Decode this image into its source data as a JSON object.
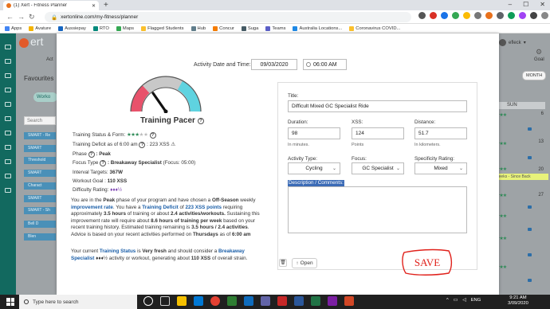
{
  "browser": {
    "tab_title": "(1) Xert - Fitness Planner",
    "new_tab": "+",
    "url": "xertonline.com/my-fitness/planner",
    "window_controls": [
      "–",
      "☐",
      "✕"
    ],
    "bookmarks": [
      "Apps",
      "Avature",
      "Aussiepay",
      "RTO",
      "Maps",
      "Flagged Students",
      "Hub",
      "Concur",
      "Suga",
      "Teams",
      "Australia Locations...",
      "Coronavirus COVID..."
    ]
  },
  "app": {
    "logo_text": "ert",
    "user_name": "efleck",
    "goal_label": "Goal",
    "month_button": "MONTH",
    "activity_tab": "Act",
    "favourites_title": "Favourites",
    "workouts_button": "Worko",
    "search_placeholder": "Search",
    "left_buttons": [
      "SMART - Re",
      "SMART",
      "Threshold",
      "SMART",
      "Charact",
      "SMART",
      "SMART - Sh",
      "Bell D",
      "Blen"
    ],
    "calendar_header": "SUN",
    "calendar_days": [
      "6",
      "13",
      "20",
      "27"
    ],
    "weeks_banner": "Weeks - Since Back"
  },
  "modal": {
    "date_label": "Activity Date and Time:",
    "date_value": "09/03/2020",
    "time_value": "06:00 AM",
    "pacer_title": "Training Pacer",
    "status_label": "Training Status & Form:",
    "deficit_text": "Training Deficit as of 6:00 am",
    "deficit_value": ": 223 XSS",
    "phase_label": "Phase",
    "phase_value": ": Peak",
    "focus_label": "Focus Type",
    "focus_value": ": Breakaway Specialist",
    "focus_extra": "(Focus: 05:00)",
    "interval_label": "Interval Targets:",
    "interval_value": "367W",
    "goal_label": "Workout Goal :",
    "goal_value": "110 XSS",
    "difficulty_label": "Difficulty Rating:",
    "difficulty_value": "♦♦♦½",
    "p1_a": "You are in the",
    "p1_peak": "Peak",
    "p1_b": "phase of your program and have chosen a",
    "p1_offseason": "Off-Season",
    "p1_c": "weekly",
    "p1_improvement": "improvement rate",
    "p1_d": ". You have a",
    "p1_deficit": "Training Deficit",
    "p1_e": "of",
    "p1_xss": "223 XSS points",
    "p1_f": "requiring approximately",
    "p1_hours": "3.5 hours",
    "p1_g": "of training or about",
    "p1_acts": "2.4 activities/workouts.",
    "p1_h": "Sustaining this improvement rate will require about",
    "p1_weekly": "8.6 hours of training per week",
    "p1_i": "based on your recent training history. Estimated training remaining is",
    "p1_remaining": "3.5 hours / 2.4 activities",
    "p1_j": ".",
    "p1_k": "Advice is based on your recent activities performed on",
    "p1_day": "Thursdays",
    "p1_l": "as of",
    "p1_time": "6:00 am",
    "p2_a": "Your current",
    "p2_status": "Training Status",
    "p2_b": "is",
    "p2_fresh": "Very fresh",
    "p2_c": "and should consider a",
    "p2_breakaway": "Breakaway Specialist",
    "p2_d": "♦♦♦½ activity or workout, generating about",
    "p2_xss": "110 XSS",
    "p2_e": "of overall strain.",
    "title_label": "Title:",
    "title_value": "Difficult Mixed GC Specialist Ride",
    "duration_label": "Duration:",
    "duration_value": "98",
    "duration_unit": "In minutes.",
    "xss_label": "XSS:",
    "xss_value": "124",
    "xss_unit": "Points",
    "distance_label": "Distance:",
    "distance_value": "51.7",
    "distance_unit": "In kilometers.",
    "activity_type_label": "Activity Type:",
    "activity_type_value": "Cycling",
    "focus_sel_label": "Focus:",
    "focus_sel_value": "GC Specialist",
    "specificity_label": "Specificity Rating:",
    "specificity_value": "Mixed",
    "description_label": "Description / Comments:",
    "open_button": "Open",
    "save_annotation": "SAVE"
  },
  "taskbar": {
    "search_placeholder": "Type here to search",
    "language": "ENG",
    "time": "9:21 AM",
    "date": "3/09/2020"
  },
  "colors": {
    "sidebar": "#12695f",
    "accent_blue": "#1a5ea8",
    "stars": "#2e8b57",
    "save_red": "#e0211b",
    "gauge_red": "#e8526b",
    "gauge_teal": "#5fd3e0"
  }
}
